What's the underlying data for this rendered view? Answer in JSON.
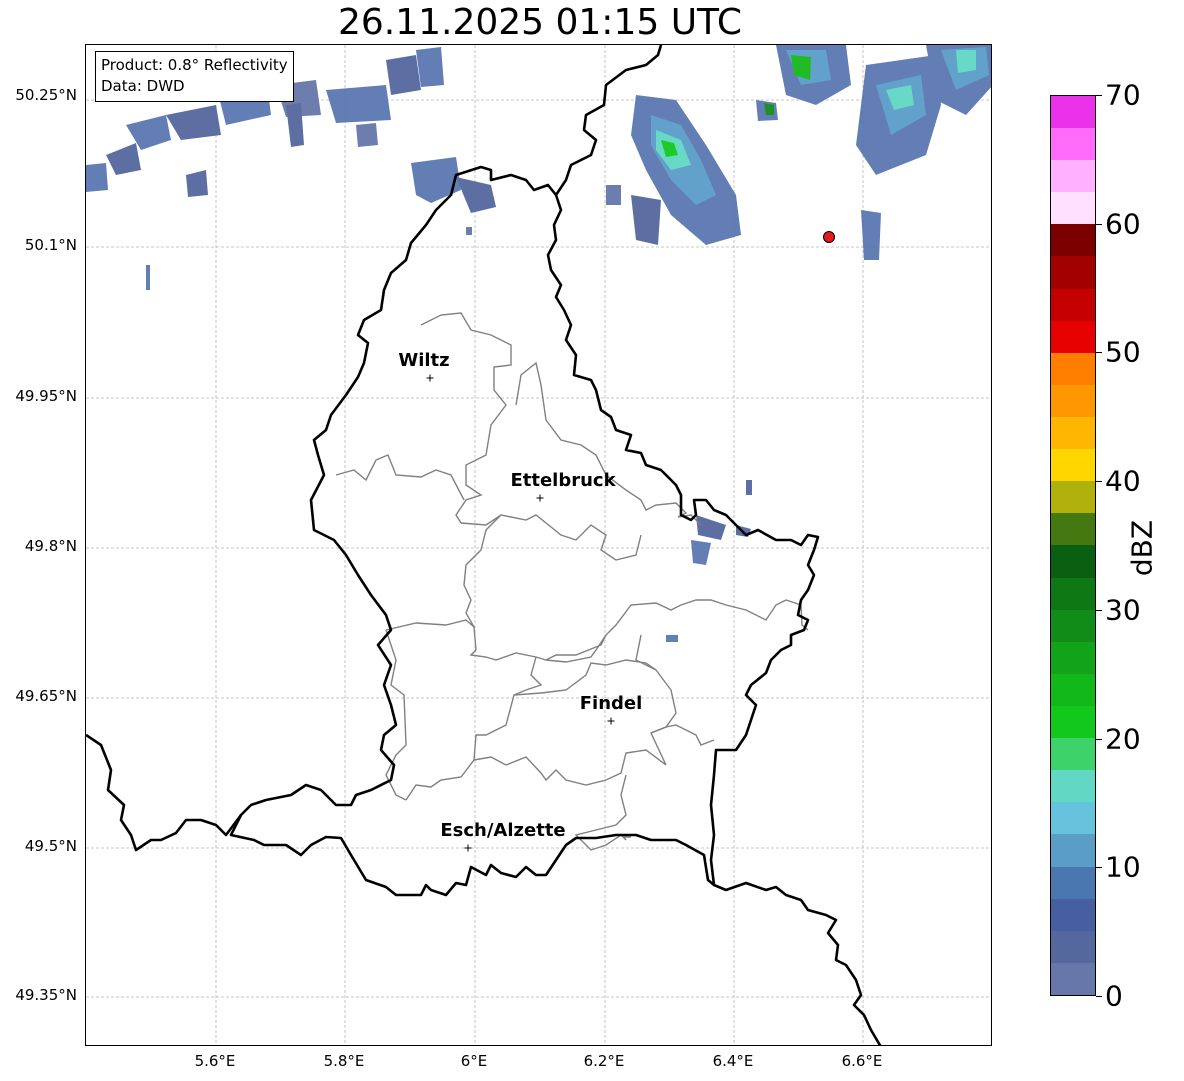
{
  "title": "26.11.2025 01:15 UTC",
  "info": {
    "product": "Product: 0.8° Reflectivity",
    "source": "Data: DWD"
  },
  "lat_labels": [
    "50.25°N",
    "50.1°N",
    "49.95°N",
    "49.8°N",
    "49.65°N",
    "49.5°N",
    "49.35°N"
  ],
  "lon_labels": [
    "5.6°E",
    "5.8°E",
    "6°E",
    "6.2°E",
    "6.4°E",
    "6.6°E"
  ],
  "cities": [
    {
      "name": "Wiltz"
    },
    {
      "name": "Ettelbruck"
    },
    {
      "name": "Findel"
    },
    {
      "name": "Esch/Alzette"
    }
  ],
  "colorbar": {
    "unit": "dBZ",
    "ticks": [
      "0",
      "10",
      "20",
      "30",
      "40",
      "50",
      "60",
      "70"
    ],
    "colors": [
      "#6677aa",
      "#55689e",
      "#455fa0",
      "#4a77b0",
      "#5a9ec8",
      "#66c2dd",
      "#60d8c4",
      "#3ed36a",
      "#12c81c",
      "#12b81a",
      "#12a31a",
      "#128c18",
      "#0e7814",
      "#0a5f10",
      "#447811",
      "#b0b10a",
      "#ffd600",
      "#ffb600",
      "#ff9800",
      "#ff7e00",
      "#e60000",
      "#c40000",
      "#a30000",
      "#7d0000",
      "#ffe0ff",
      "#ffb0ff",
      "#ff6cfa",
      "#ea32ea"
    ]
  }
}
